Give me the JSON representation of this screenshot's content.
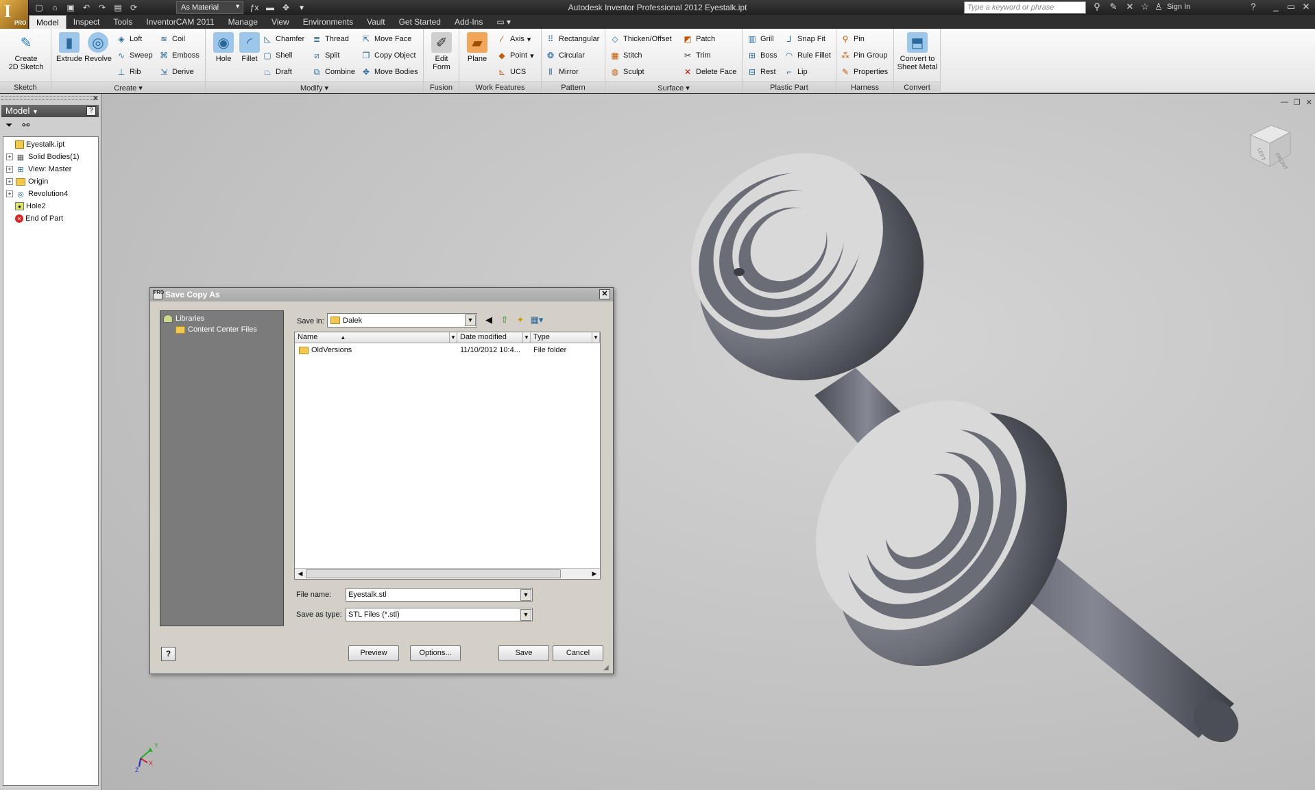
{
  "app": {
    "title": "Autodesk Inventor Professional 2012    Eyestalk.ipt",
    "logo": "I",
    "edition": "PRO",
    "material": "As Material",
    "search_placeholder": "Type a keyword or phrase",
    "sign_in": "Sign In"
  },
  "tabs": [
    "Model",
    "Inspect",
    "Tools",
    "InventorCAM 2011",
    "Manage",
    "View",
    "Environments",
    "Vault",
    "Get Started",
    "Add-Ins"
  ],
  "ribbon": {
    "sketch": {
      "title": "Sketch",
      "create_2d_sketch": "Create\n2D Sketch"
    },
    "create": {
      "title": "Create",
      "extrude": "Extrude",
      "revolve": "Revolve",
      "loft": "Loft",
      "sweep": "Sweep",
      "rib": "Rib",
      "coil": "Coil",
      "emboss": "Emboss",
      "derive": "Derive"
    },
    "modify": {
      "title": "Modify",
      "hole": "Hole",
      "fillet": "Fillet",
      "chamfer": "Chamfer",
      "shell": "Shell",
      "draft": "Draft",
      "thread": "Thread",
      "split": "Split",
      "combine": "Combine",
      "move_face": "Move Face",
      "copy_object": "Copy Object",
      "move_bodies": "Move Bodies"
    },
    "fusion": {
      "title": "Fusion",
      "edit_form": "Edit\nForm"
    },
    "work_features": {
      "title": "Work Features",
      "plane": "Plane",
      "axis": "Axis",
      "point": "Point",
      "ucs": "UCS"
    },
    "pattern": {
      "title": "Pattern",
      "rectangular": "Rectangular",
      "circular": "Circular",
      "mirror": "Mirror"
    },
    "surface": {
      "title": "Surface",
      "thicken_offset": "Thicken/Offset",
      "stitch": "Stitch",
      "sculpt": "Sculpt",
      "patch": "Patch",
      "trim": "Trim",
      "delete_face": "Delete Face"
    },
    "plastic_part": {
      "title": "Plastic Part",
      "grill": "Grill",
      "boss": "Boss",
      "rest": "Rest",
      "snap_fit": "Snap Fit",
      "rule_fillet": "Rule Fillet",
      "lip": "Lip"
    },
    "harness": {
      "title": "Harness",
      "pin": "Pin",
      "pin_group": "Pin Group",
      "properties": "Properties"
    },
    "convert": {
      "title": "Convert",
      "convert_to_sheet_metal": "Convert to\nSheet Metal"
    }
  },
  "browser": {
    "title": "Model",
    "tree": [
      {
        "label": "Eyestalk.ipt",
        "icon": "part-icon",
        "expander": ""
      },
      {
        "label": "Solid Bodies(1)",
        "icon": "solid-bodies-icon",
        "expander": "+"
      },
      {
        "label": "View: Master",
        "icon": "view-rep-icon",
        "expander": "+"
      },
      {
        "label": "Origin",
        "icon": "origin-folder-icon",
        "expander": "+"
      },
      {
        "label": "Revolution4",
        "icon": "revolve-feature-icon",
        "expander": "+"
      },
      {
        "label": "Hole2",
        "icon": "hole-feature-icon",
        "expander": ""
      },
      {
        "label": "End of Part",
        "icon": "end-of-part-icon",
        "expander": ""
      }
    ]
  },
  "viewcube": {
    "top": "LEFT",
    "front": "FRONT"
  },
  "triad": {
    "x": "X",
    "y": "Y",
    "z": "Z"
  },
  "dialog": {
    "title": "Save Copy As",
    "title_icon": "PRO",
    "libraries": [
      "Libraries",
      "Content Center Files"
    ],
    "save_in_label": "Save in:",
    "save_in_value": "Dalek",
    "columns": [
      "Name",
      "Date modified",
      "Type"
    ],
    "files": [
      {
        "name": "OldVersions",
        "date": "11/10/2012 10:4...",
        "type": "File folder"
      }
    ],
    "file_name_label": "File name:",
    "file_name_value": "Eyestalk.stl",
    "save_as_type_label": "Save as type:",
    "save_as_type_value": "STL Files (*.stl)",
    "buttons": {
      "preview": "Preview",
      "options": "Options...",
      "save": "Save",
      "cancel": "Cancel"
    }
  }
}
